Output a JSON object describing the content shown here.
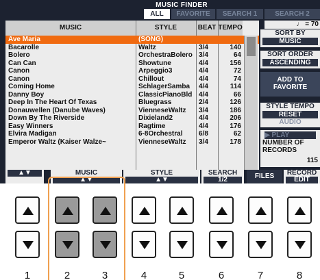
{
  "header": {
    "title": "MUSIC FINDER",
    "tabs": [
      "ALL",
      "FAVORITE",
      "SEARCH 1",
      "SEARCH 2"
    ]
  },
  "columns": {
    "music": "MUSIC",
    "style": "STYLE",
    "beat": "BEAT",
    "tempo": "TEMPO"
  },
  "rows": [
    {
      "music": "Ave Maria",
      "style": "(SONG)",
      "beat": "",
      "tempo": ""
    },
    {
      "music": "Bacarolle",
      "style": "Waltz",
      "beat": "3/4",
      "tempo": "140"
    },
    {
      "music": "Bolero",
      "style": "OrchestraBolero",
      "beat": "3/4",
      "tempo": "64"
    },
    {
      "music": "Can Can",
      "style": "Showtune",
      "beat": "4/4",
      "tempo": "156"
    },
    {
      "music": "Canon",
      "style": "Arpeggio3",
      "beat": "4/4",
      "tempo": "72"
    },
    {
      "music": "Canon",
      "style": "Chillout",
      "beat": "4/4",
      "tempo": "74"
    },
    {
      "music": "Coming Home",
      "style": "SchlagerSamba",
      "beat": "4/4",
      "tempo": "114"
    },
    {
      "music": "Danny Boy",
      "style": "ClassicPianoBld",
      "beat": "4/4",
      "tempo": "66"
    },
    {
      "music": "Deep In The Heart Of Texas",
      "style": "Bluegrass",
      "beat": "2/4",
      "tempo": "126"
    },
    {
      "music": "Donauwellen (Danube Waves)",
      "style": "VienneseWaltz",
      "beat": "3/4",
      "tempo": "186"
    },
    {
      "music": "Down By The Riverside",
      "style": "Dixieland2",
      "beat": "4/4",
      "tempo": "206"
    },
    {
      "music": "Easy Winners",
      "style": "Ragtime",
      "beat": "4/4",
      "tempo": "176"
    },
    {
      "music": "Elvira Madigan",
      "style": "6-8Orchestral",
      "beat": "6/8",
      "tempo": "62"
    },
    {
      "music": "Emperor Waltz (Kaiser Walze~",
      "style": "VienneseWaltz",
      "beat": "3/4",
      "tempo": "178"
    }
  ],
  "right_panel": {
    "tempo_readout": "♩ = 70",
    "sort_by_label": "SORT BY",
    "sort_by_value": "MUSIC",
    "sort_order_label": "SORT ORDER",
    "sort_order_value": "ASCENDING",
    "add_favorite_line1": "ADD TO",
    "add_favorite_line2": "FAVORITE",
    "style_tempo_label": "STYLE TEMPO",
    "style_tempo_value": "RESET",
    "audio_label": "AUDIO",
    "play_label": "▶ PLAY",
    "records_label_1": "NUMBER OF",
    "records_label_2": "RECORDS",
    "records_count": "115"
  },
  "bottom": {
    "arrows_1": "▲▼",
    "music_label": "MUSIC",
    "music_arrows": "▲▼",
    "style_label": "STYLE",
    "style_arrows": "▲▼",
    "search_label": "SEARCH",
    "search_value": "1/2",
    "files_label": "FILES",
    "record_label": "RECORD",
    "edit_label": "EDIT"
  },
  "physical_buttons": {
    "numbers": [
      "1",
      "2",
      "3",
      "4",
      "5",
      "6",
      "7",
      "8"
    ],
    "highlighted": [
      "2",
      "3"
    ],
    "highlight_color": "#f0a050",
    "selection_color": "#f06a10"
  }
}
